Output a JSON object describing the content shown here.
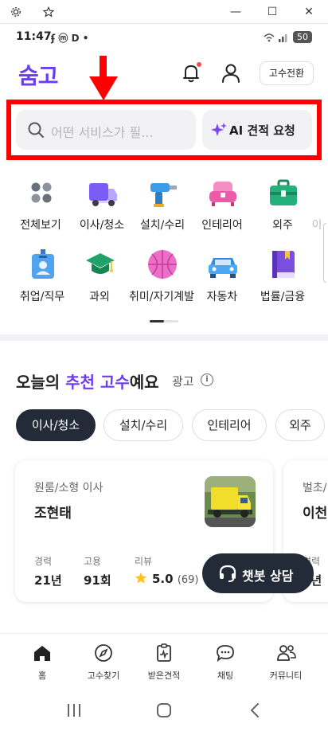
{
  "window": {
    "gear_icon": "gear-icon",
    "star_icon": "star-icon",
    "minimize": "—",
    "maximize": "☐",
    "close": "✕"
  },
  "status_bar": {
    "time": "11:47",
    "indicators": "ʄ ⓜ D •",
    "battery": "50"
  },
  "header": {
    "logo": "숨고",
    "switch_label": "고수전환"
  },
  "search": {
    "placeholder": "어떤 서비스가 필...",
    "ai_label": "AI 견적 요청"
  },
  "categories": [
    {
      "label": "전체보기",
      "icon": "grid-dots-icon"
    },
    {
      "label": "이사/청소",
      "icon": "truck-icon"
    },
    {
      "label": "설치/수리",
      "icon": "drill-icon"
    },
    {
      "label": "인테리어",
      "icon": "sofa-icon"
    },
    {
      "label": "외주",
      "icon": "briefcase-icon"
    },
    {
      "label": "이",
      "icon": "partial-icon"
    },
    {
      "label": "취업/직무",
      "icon": "badge-icon"
    },
    {
      "label": "과외",
      "icon": "graduation-cap-icon"
    },
    {
      "label": "취미/자기계발",
      "icon": "ball-icon"
    },
    {
      "label": "자동차",
      "icon": "car-icon"
    },
    {
      "label": "법률/금융",
      "icon": "book-icon"
    }
  ],
  "recommend": {
    "title_pre": "오늘의 ",
    "title_accent": "추천 고수",
    "title_post": "예요",
    "ad": "광고",
    "chips": [
      "이사/청소",
      "설치/수리",
      "인테리어",
      "외주"
    ],
    "cards": [
      {
        "type": "원룸/소형 이사",
        "name": "조현태",
        "career_label": "경력",
        "career": "21년",
        "hire_label": "고용",
        "hire": "91회",
        "review_label": "리뷰",
        "rating": "5.0",
        "review_count": "(69)"
      },
      {
        "type": "벌초/",
        "name": "이천",
        "career_label": "경력",
        "career": "5년"
      }
    ],
    "chatbot": "챗봇 상담"
  },
  "bottom_nav": [
    {
      "label": "홈",
      "icon": "home-icon"
    },
    {
      "label": "고수찾기",
      "icon": "compass-icon"
    },
    {
      "label": "받은견적",
      "icon": "quote-doc-icon"
    },
    {
      "label": "채팅",
      "icon": "chat-icon"
    },
    {
      "label": "커뮤니티",
      "icon": "community-icon"
    }
  ],
  "colors": {
    "brand": "#6c3cf0",
    "highlight": "#ff0000",
    "dark": "#232a38"
  }
}
